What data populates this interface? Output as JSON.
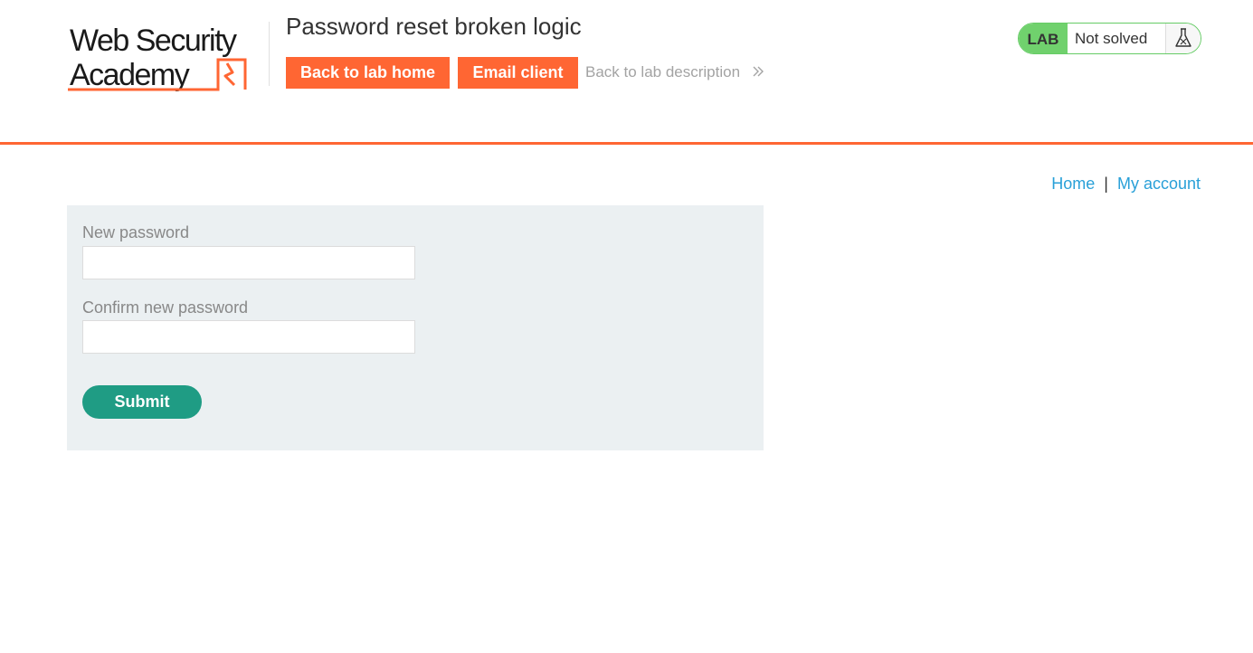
{
  "header": {
    "logo_text": "Web Security Academy",
    "lab_title": "Password reset broken logic",
    "back_to_lab_home": "Back to lab home",
    "email_client": "Email client",
    "back_to_lab_description": "Back to lab description",
    "lab_badge": {
      "label": "LAB",
      "status": "Not solved"
    }
  },
  "nav": {
    "home": "Home",
    "separator": "|",
    "my_account": "My account"
  },
  "form": {
    "new_password_label": "New password",
    "new_password_value": "",
    "confirm_password_label": "Confirm new password",
    "confirm_password_value": "",
    "submit_label": "Submit"
  },
  "colors": {
    "accent_orange": "#ff6633",
    "submit_green": "#1f9c84",
    "lab_green": "#70d16d",
    "link_blue": "#29a0d8",
    "panel_bg": "#ebf0f2"
  }
}
